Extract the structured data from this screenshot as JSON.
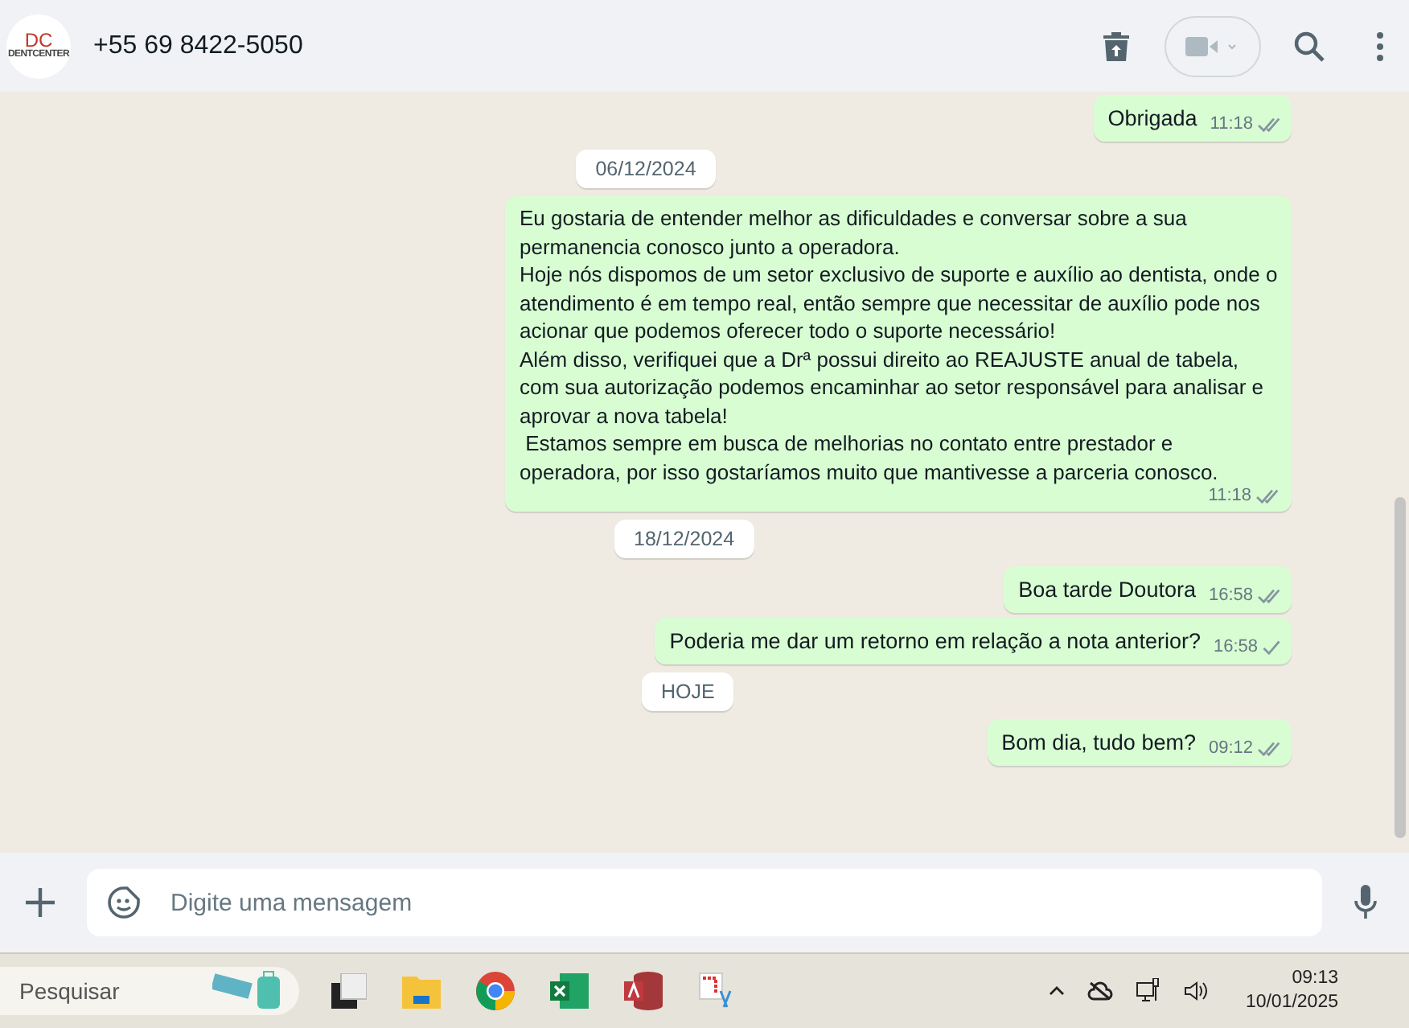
{
  "header": {
    "contact": "+55 69 8422-5050",
    "logo_mark": "DC",
    "logo_text": "DENTCENTER"
  },
  "messages": [
    {
      "kind": "message",
      "text": "Obrigada",
      "time": "11:18",
      "delivered": true
    },
    {
      "kind": "date",
      "text": "06/12/2024"
    },
    {
      "kind": "message",
      "text": "Eu gostaria de entender melhor as dificuldades e conversar sobre a sua permanencia conosco junto a operadora.\nHoje nós dispomos de um setor exclusivo de suporte e auxílio ao dentista, onde o atendimento é em tempo real, então sempre que necessitar de auxílio pode nos acionar que podemos oferecer todo o suporte necessário!\nAlém disso, verifiquei que a Drª possui direito ao REAJUSTE anual de tabela, com sua autorização podemos encaminhar ao setor responsável para analisar e aprovar a nova tabela!\n Estamos sempre em busca de melhorias no contato entre prestador e operadora, por isso gostaríamos muito que mantivesse a parceria conosco.",
      "time": "11:18",
      "delivered": true
    },
    {
      "kind": "date",
      "text": "18/12/2024"
    },
    {
      "kind": "message",
      "text": "Boa tarde Doutora",
      "time": "16:58",
      "delivered": true
    },
    {
      "kind": "message",
      "text": "Poderia me dar um retorno em relação a nota anterior?",
      "time": "16:58",
      "delivered": false
    },
    {
      "kind": "date",
      "text": "HOJE"
    },
    {
      "kind": "message",
      "text": "Bom dia, tudo bem?",
      "time": "09:12",
      "delivered": true
    }
  ],
  "composer": {
    "placeholder": "Digite uma mensagem"
  },
  "taskbar": {
    "search_placeholder": "Pesquisar",
    "time": "09:13",
    "date": "10/01/2025"
  }
}
